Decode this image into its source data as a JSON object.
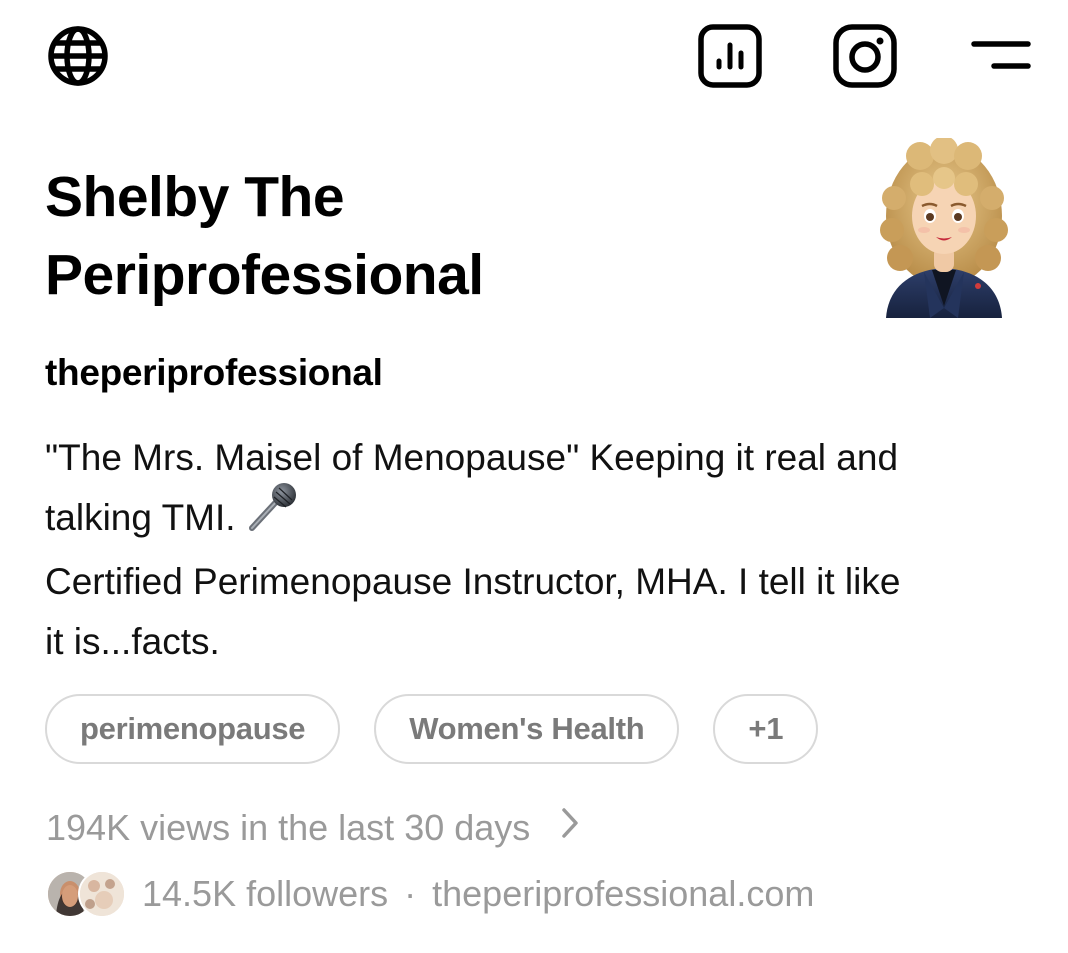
{
  "header": {
    "icons": [
      "globe-icon",
      "insights-icon",
      "instagram-icon",
      "menu-icon"
    ]
  },
  "profile": {
    "display_name_line1": "Shelby The",
    "display_name_line2": "Periprofessional",
    "username": "theperiprofessional",
    "avatar_icon": "memoji-avatar-icon",
    "bio": {
      "line1": "\"The Mrs. Maisel of Menopause\" Keeping it real and",
      "line2": "talking TMI.",
      "line2_icon": "microphone-icon",
      "line3": "Certified Perimenopause Instructor, MHA.  I tell it like",
      "line4": "it is...facts."
    },
    "tags": [
      "perimenopause",
      "Women's Health",
      "+1"
    ],
    "views_text": "194K views in the last 30 days",
    "followers_text": "14.5K followers",
    "separator": "·",
    "website": "theperiprofessional.com"
  },
  "colors": {
    "text": "#000000",
    "muted": "#9a9a9a",
    "tag_border": "#d9d9d9"
  }
}
